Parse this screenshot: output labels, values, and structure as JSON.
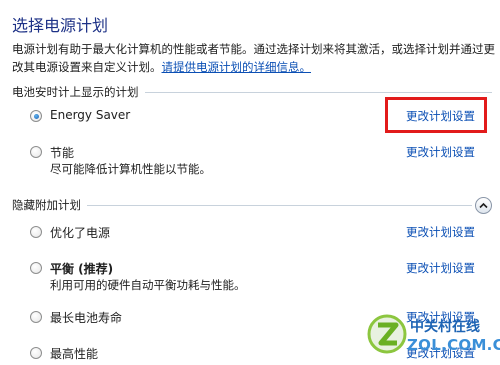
{
  "header": {
    "title": "选择电源计划"
  },
  "intro": {
    "text": "电源计划有助于最大化计算机的性能或者节能。通过选择计划来将其激活，或选择计划并通过更改其电源设置来自定义计划。",
    "link": "请提供电源计划的详细信息。"
  },
  "battery_section": {
    "header": "电池安时计上显示的计划",
    "plans": [
      {
        "name": "Energy Saver",
        "description": "",
        "selected": true,
        "change_label": "更改计划设置"
      },
      {
        "name": "节能",
        "description": "尽可能降低计算机性能以节能。",
        "selected": false,
        "change_label": "更改计划设置"
      }
    ]
  },
  "hidden_section": {
    "header": "隐藏附加计划",
    "collapse_icon": "chevron-up-icon",
    "plans": [
      {
        "name": "优化了电源",
        "description": "",
        "selected": false,
        "change_label": "更改计划设置"
      },
      {
        "name": "平衡 (推荐)",
        "description": "利用可用的硬件自动平衡功耗与性能。",
        "selected": false,
        "change_label": "更改计划设置"
      },
      {
        "name": "最长电池寿命",
        "description": "",
        "selected": false,
        "change_label": "更改计划设置"
      },
      {
        "name": "最高性能",
        "description": "",
        "selected": false,
        "change_label": "更改计划设置"
      }
    ]
  },
  "watermark": {
    "brand_cn": "中关村在线",
    "brand_en": "ZOL.COM.CN"
  },
  "colors": {
    "title": "#1e3287",
    "link": "#0b4fb4",
    "highlight": "#e21b1b",
    "watermark": "#1e64b4"
  }
}
